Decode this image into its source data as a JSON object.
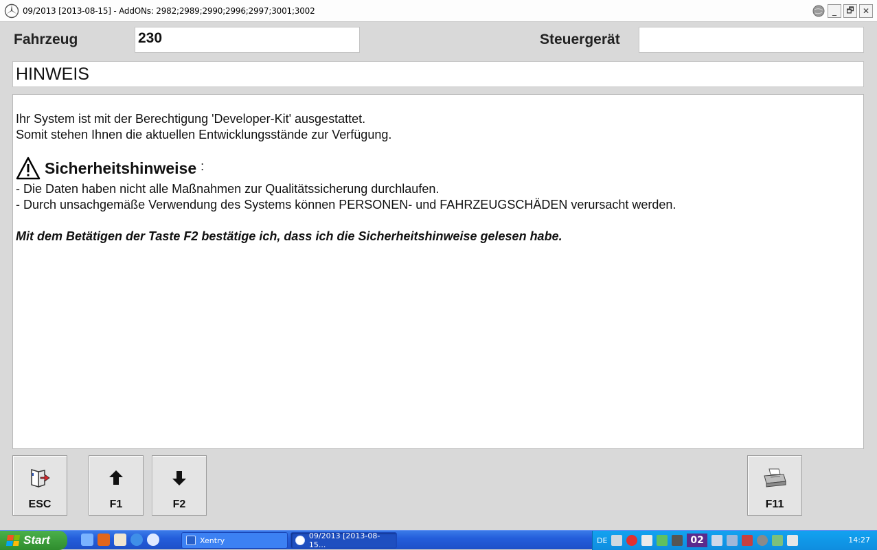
{
  "window": {
    "title": "09/2013 [2013-08-15] - AddONs: 2982;2989;2990;2996;2997;3001;3002",
    "minimize": "_",
    "restore": "🗗",
    "close": "✕"
  },
  "header": {
    "vehicle_label": "Fahrzeug",
    "vehicle_value": "230",
    "ecu_label": "Steuergerät",
    "ecu_value": ""
  },
  "notice": {
    "title": "HINWEIS",
    "line1": "Ihr System ist mit der Berechtigung 'Developer-Kit' ausgestattet.",
    "line2": "Somit stehen Ihnen die aktuellen Entwicklungsstände zur Verfügung.",
    "safety_heading": "Sicherheitshinweise",
    "safety_colon": ":",
    "safety_item1": "- Die Daten haben nicht alle Maßnahmen zur Qualitätssicherung durchlaufen.",
    "safety_item2": "- Durch unsachgemäße Verwendung des Systems können PERSONEN- und FAHRZEUGSCHÄDEN verursacht werden.",
    "confirm": "Mit dem Betätigen der Taste F2 bestätige ich, dass ich die Sicherheitshinweise gelesen habe."
  },
  "function_keys": {
    "esc": "ESC",
    "f1": "F1",
    "f2": "F2",
    "f11": "F11"
  },
  "taskbar": {
    "start": "Start",
    "tasks": [
      "Xentry",
      "09/2013 [2013-08-15..."
    ],
    "lang": "DE",
    "tray_number": "02",
    "clock": "14:27"
  },
  "colors": {
    "taskbar_blue": "#245edb",
    "start_green": "#3a9e39",
    "tray_blue": "#0f8ddf"
  }
}
